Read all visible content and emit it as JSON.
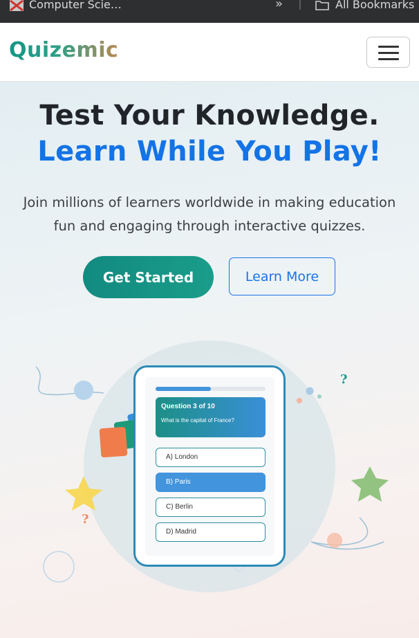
{
  "bookmarks_bar": {
    "tab_title": "Computer Scie…",
    "overflow_icon": "chevron-double-right-icon",
    "all_bookmarks_label": "All Bookmarks"
  },
  "navbar": {
    "brand": "Quizemic",
    "toggler_icon": "hamburger-menu-icon"
  },
  "hero": {
    "headline_line1": "Test Your Knowledge.",
    "headline_line2": "Learn While You Play!",
    "lead": "Join millions of learners worldwide in making education fun and engaging through interactive quizzes.",
    "primary_button": "Get Started",
    "secondary_button": "Learn More"
  },
  "quiz_preview": {
    "progress": 0.5,
    "question_number": "Question 3 of 10",
    "question_text": "What is the capital of France?",
    "options": [
      {
        "label": "A) London",
        "selected": false
      },
      {
        "label": "B) Paris",
        "selected": true
      },
      {
        "label": "C) Berlin",
        "selected": false
      },
      {
        "label": "D) Madrid",
        "selected": false
      }
    ]
  },
  "decorations": {
    "question_mark": "?"
  },
  "colors": {
    "accent_teal": "#1a9d8a",
    "accent_blue": "#1473e6",
    "dark_text": "#212529"
  }
}
